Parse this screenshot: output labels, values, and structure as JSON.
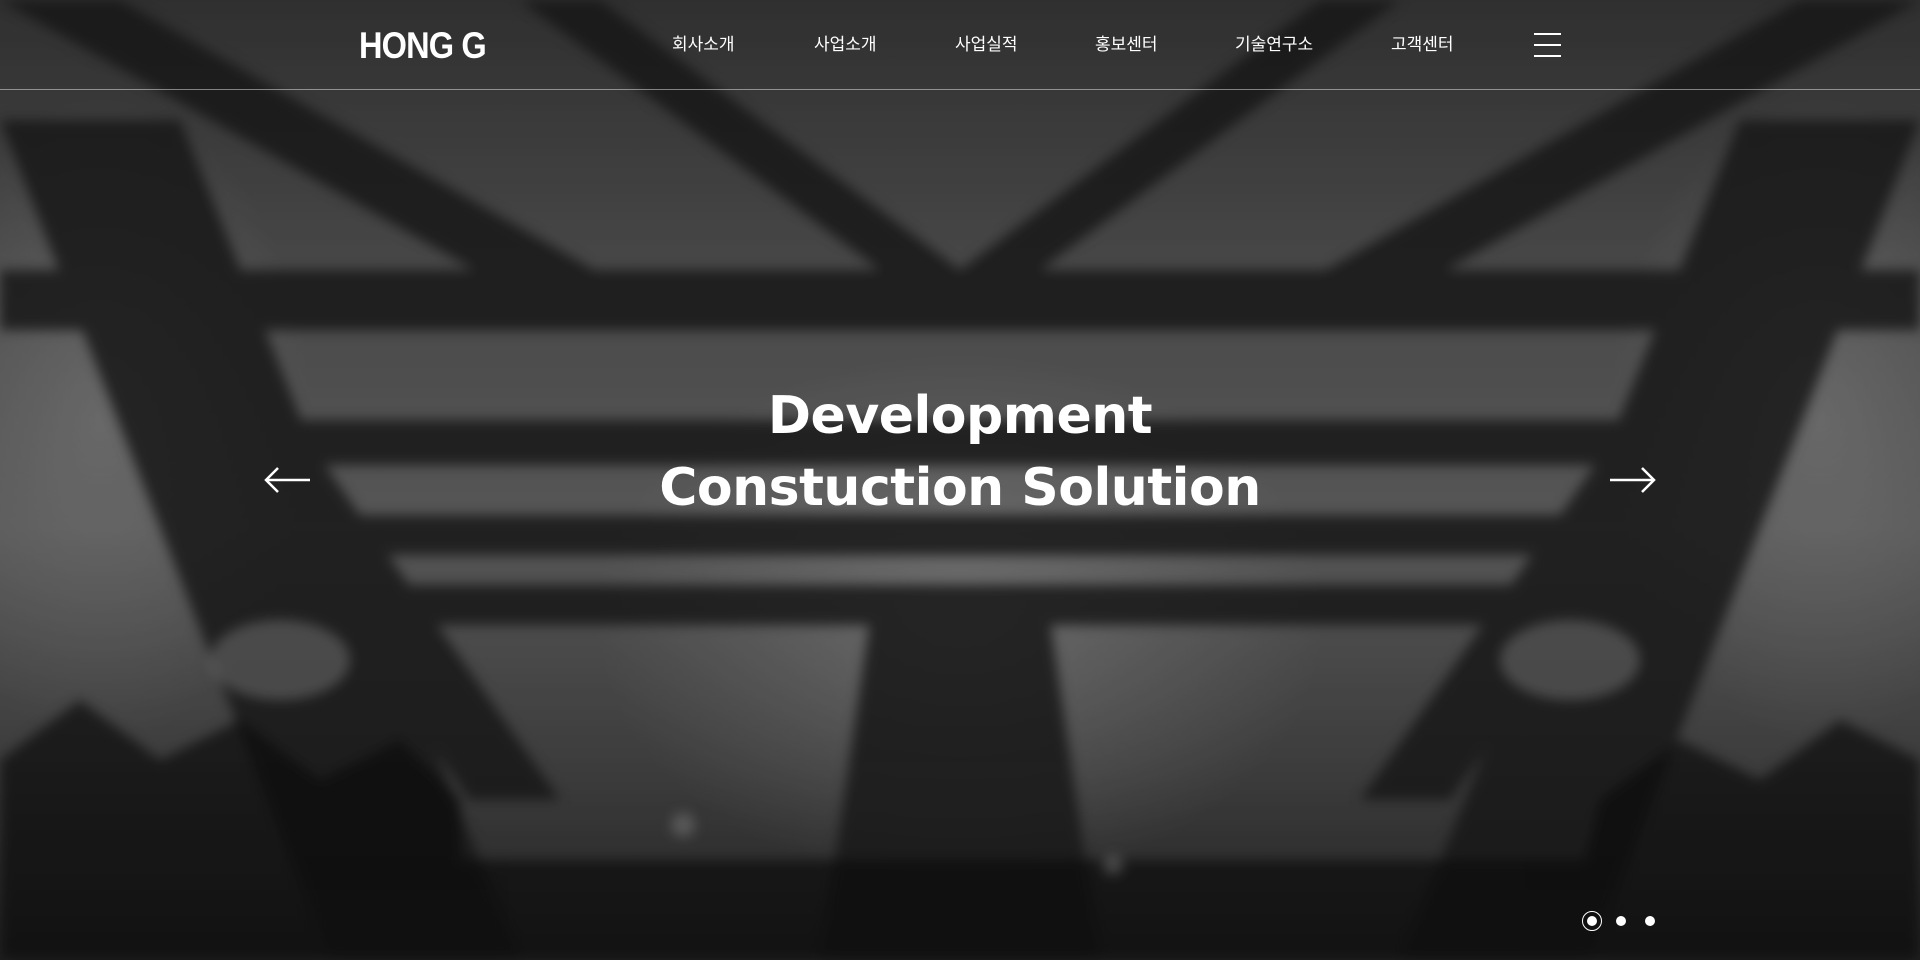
{
  "brand": {
    "logo_text": "HONG G"
  },
  "nav": {
    "items": [
      {
        "label": "회사소개"
      },
      {
        "label": "사업소개"
      },
      {
        "label": "사업실적"
      },
      {
        "label": "홍보센터"
      },
      {
        "label": "기술연구소"
      },
      {
        "label": "고객센터"
      }
    ],
    "menu_icon": "hamburger-menu-icon"
  },
  "hero": {
    "headline_line1": "Development",
    "headline_line2": "Constuction Solution",
    "prev_icon": "arrow-left-icon",
    "next_icon": "arrow-right-icon",
    "slides_total": 3,
    "active_slide": 1,
    "background": "blurred grayscale photo of a steel bridge"
  },
  "colors": {
    "text": "#ffffff",
    "header_border": "rgba(255,255,255,0.45)"
  }
}
